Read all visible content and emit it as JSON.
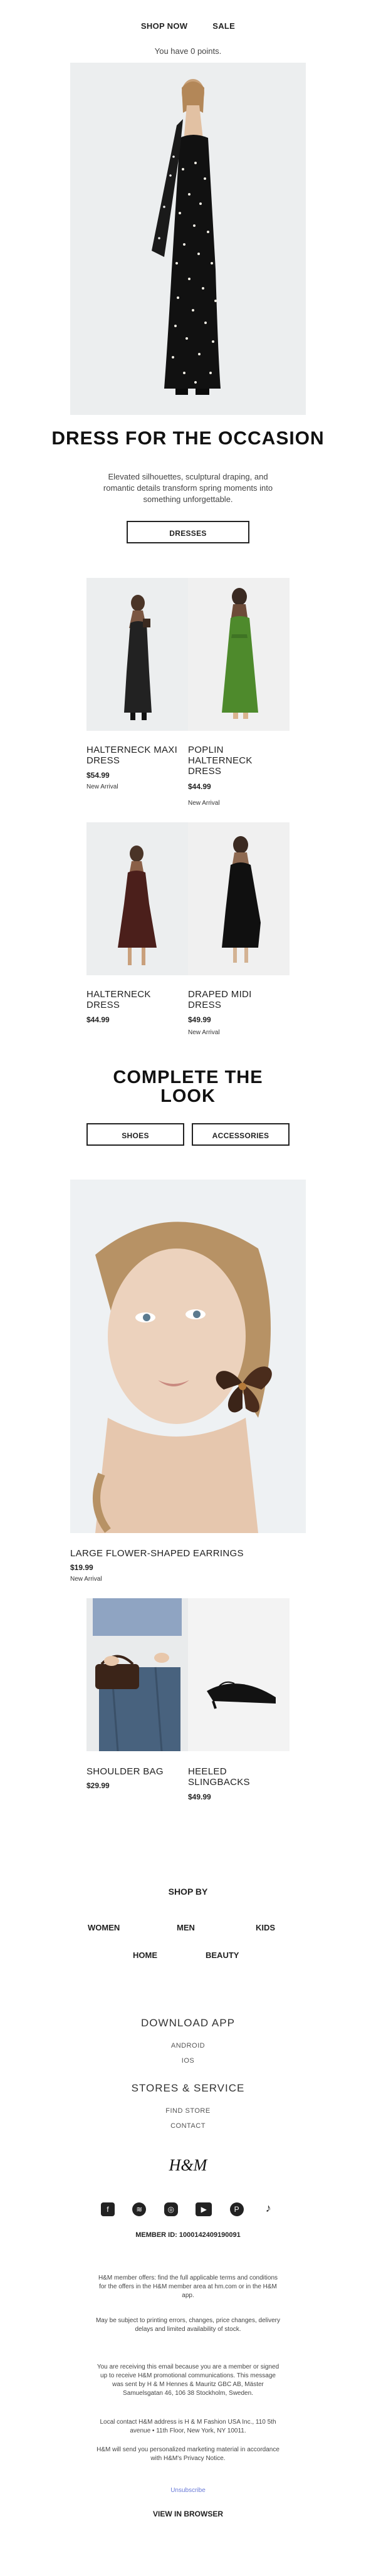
{
  "nav": {
    "shop_now": "SHOP NOW",
    "sale": "SALE"
  },
  "points_text": "You have 0 points.",
  "hero": {
    "title": "DRESS FOR THE OCCASION",
    "subtitle": "Elevated silhouettes, sculptural draping, and romantic details transform spring moments into something unforgettable.",
    "cta": "DRESSES"
  },
  "products_row1": [
    {
      "name": "HALTERNECK MAXI DRESS",
      "price": "$54.99",
      "badge": "New Arrival"
    },
    {
      "name": "POPLIN HALTERNECK DRESS",
      "price": "$44.99",
      "badge": "New Arrival"
    }
  ],
  "products_row2": [
    {
      "name": "HALTERNECK DRESS",
      "price": "$44.99",
      "badge": ""
    },
    {
      "name": "DRAPED MIDI DRESS",
      "price": "$49.99",
      "badge": "New Arrival"
    }
  ],
  "complete": {
    "title": "COMPLETE THE LOOK",
    "shoes": "SHOES",
    "accessories": "ACCESSORIES"
  },
  "feature": {
    "name": "LARGE FLOWER-SHAPED EARRINGS",
    "price": "$19.99",
    "badge": "New Arrival"
  },
  "products_row3": [
    {
      "name": "SHOULDER BAG",
      "price": "$29.99"
    },
    {
      "name": "HEELED SLINGBACKS",
      "price": "$49.99"
    }
  ],
  "shop_by": {
    "title": "SHOP BY",
    "women": "WOMEN",
    "men": "MEN",
    "kids": "KIDS",
    "home": "HOME",
    "beauty": "BEAUTY"
  },
  "footer": {
    "download": "DOWNLOAD APP",
    "android": "ANDROID",
    "ios": "IOS",
    "stores": "STORES & SERVICE",
    "find_store": "FIND STORE",
    "contact": "CONTACT",
    "logo": "H&M",
    "member_label": "MEMBER ID:",
    "member_id": "1000142409190091",
    "legal1": "H&M member offers: find the full applicable terms and conditions for the offers in the H&M member area at hm.com or in the H&M app.",
    "legal2": "May be subject to printing errors, changes, price changes, delivery delays and limited availability of stock.",
    "legal3": "You are receiving this email because you are a member or signed up to receive H&M promotional communications. This message was sent by H & M Hennes & Mauritz GBC AB, Mäster Samuelsgatan 46, 106 38 Stockholm, Sweden.",
    "legal4": "Local contact H&M address is H & M Fashion USA Inc., 110 5th avenue • 11th Floor, New York, NY 10011.",
    "legal5": "H&M will send you personalized marketing material in accordance with H&M's Privacy Notice.",
    "unsubscribe": "Unsubscribe",
    "view_browser": "VIEW IN BROWSER"
  },
  "social": [
    "facebook-icon",
    "spotify-icon",
    "instagram-icon",
    "youtube-icon",
    "pinterest-icon",
    "tiktok-icon"
  ]
}
